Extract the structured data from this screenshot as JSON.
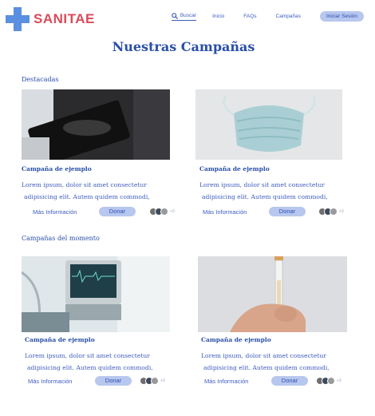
{
  "brand": {
    "name": "SANITAE",
    "accent": "#5b8fe0",
    "brand_color": "#d94b5a"
  },
  "nav": {
    "search_label": "Buscar",
    "links": [
      "Inicio",
      "FAQs",
      "Campañas"
    ],
    "login_label": "Iniciar Sesión"
  },
  "page_title": "Nuestras Campañas",
  "sections": [
    {
      "title": "Destacadas",
      "cards": [
        {
          "image": "tablet-medical-scan",
          "title": "Campaña de ejemplo",
          "desc_line1": "Lorem ipsum, dolor sit amet consectetur",
          "desc_line2": "adipisicing elit. Autem quidem commodi,",
          "more_label": "Más Información",
          "donate_label": "Donar",
          "supporters_count": "+3"
        },
        {
          "image": "surgical-mask",
          "title": "Campaña de ejemplo",
          "desc_line1": "Lorem ipsum, dolor sit amet consectetur",
          "desc_line2": "adipisicing elit. Autem quidem commodi,",
          "more_label": "Más Información",
          "donate_label": "Donar",
          "supporters_count": "+3"
        }
      ]
    },
    {
      "title": "Campañas del momento",
      "cards": [
        {
          "image": "medical-monitor",
          "title": "Campaña de ejemplo",
          "desc_line1": "Lorem ipsum, dolor sit amet consectetur",
          "desc_line2": "adipisicing elit. Autem quidem commodi,",
          "more_label": "Más Información",
          "donate_label": "Donar",
          "supporters_count": "+3"
        },
        {
          "image": "syringe-in-hand",
          "title": "Campaña de ejemplo",
          "desc_line1": "Lorem ipsum, dolor sit amet consectetur",
          "desc_line2": "adipisicing elit. Autem quidem commodi,",
          "more_label": "Más Información",
          "donate_label": "Donar",
          "supporters_count": "+3"
        }
      ]
    }
  ]
}
